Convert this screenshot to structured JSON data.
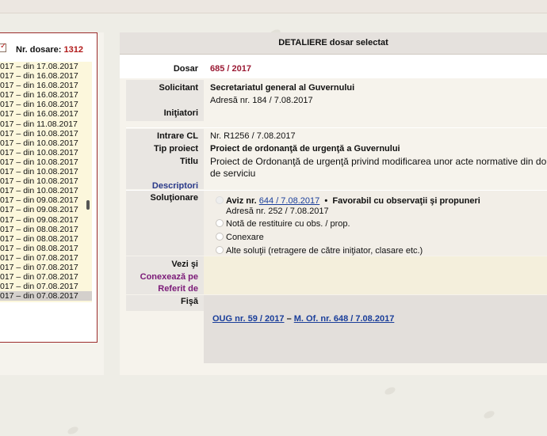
{
  "left": {
    "dosare_label": "Nr. dosare:",
    "dosare_count": "1312",
    "items": [
      "017 – din 17.08.2017",
      "017 – din 16.08.2017",
      "017 – din 16.08.2017",
      "017 – din 16.08.2017",
      "017 – din 16.08.2017",
      "017 – din 16.08.2017",
      "017 – din 11.08.2017",
      "017 – din 10.08.2017",
      "017 – din 10.08.2017",
      "017 – din 10.08.2017",
      "017 – din 10.08.2017",
      "017 – din 10.08.2017",
      "017 – din 10.08.2017",
      "017 – din 10.08.2017",
      "017 – din 09.08.2017",
      "017 – din 09.08.2017",
      "017 – din 09.08.2017",
      "017 – din 08.08.2017",
      "017 – din 08.08.2017",
      "017 – din 08.08.2017",
      "017 – din 07.08.2017",
      "017 – din 07.08.2017",
      "017 – din 07.08.2017",
      "017 – din 07.08.2017",
      "017 – din 07.08.2017"
    ],
    "selected_index": 24
  },
  "main": {
    "title": "DETALIERE dosar selectat",
    "labels": {
      "dosar": "Dosar",
      "solicitant": "Solicitant",
      "initiatori": "Iniţiatori",
      "intrare": "Intrare CL",
      "tip": "Tip proiect",
      "titlu": "Titlu",
      "descriptori": "Descriptori",
      "solutionare": "Soluţionare",
      "vezi": "Vezi şi",
      "conexeaza": "Conexează pe",
      "referit": "Referit de",
      "fisa": "Fişă"
    },
    "dosar": "685 / 2017",
    "solicitant": "Secretariatul general al Guvernului",
    "adresa": "Adresă nr. 184 / 7.08.2017",
    "intrare": "Nr. R1256 / 7.08.2017",
    "tip": "Proiect de ordonanţă de urgenţă a Guvernului",
    "titlu_1": "Proiect de Ordonanţă de urgenţă privind modificarea unor acte normative din dome",
    "titlu_2": "de serviciu",
    "solutionare": {
      "aviz_prefix": "Aviz nr.",
      "aviz_link": "644 / 7.08.2017",
      "aviz_sep": "•",
      "aviz_result": "Favorabil cu observaţii şi propuneri",
      "aviz_adresa": "Adresă nr. 252 / 7.08.2017",
      "opt2": "Notă de restituire cu obs. / prop.",
      "opt3": "Conexare",
      "opt4": "Alte soluţii (retragere de către iniţiator, clasare etc.)"
    },
    "fisa": {
      "oug_link": "OUG nr. 59 / 2017",
      "dash": "–",
      "mof_link": "M. Of. nr. 648 / 7.08.2017"
    }
  }
}
